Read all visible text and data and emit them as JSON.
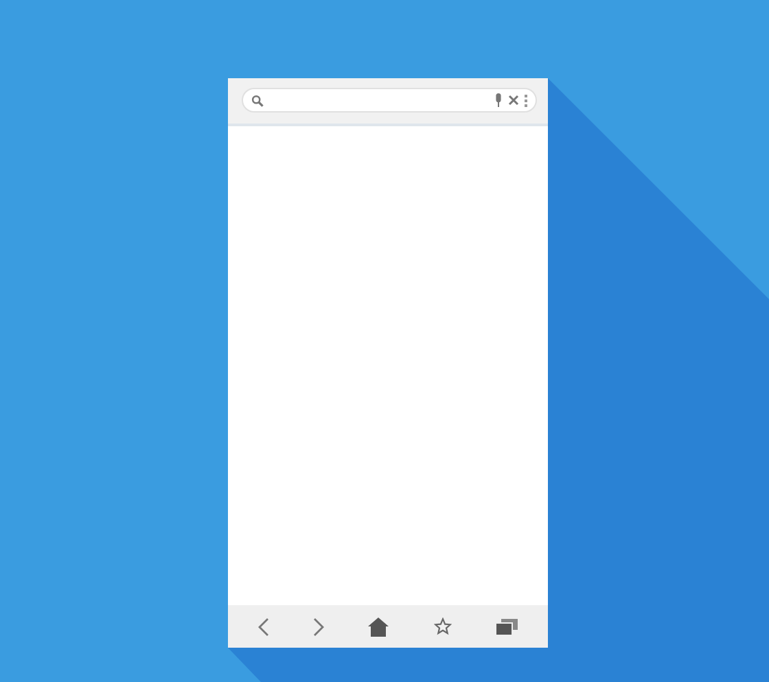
{
  "search_bar": {
    "actions": [
      {
        "kind": "mic"
      },
      {
        "kind": "clear"
      },
      {
        "kind": "menu"
      }
    ]
  },
  "toolbar": [
    {
      "kind": "back"
    },
    {
      "kind": "forward"
    },
    {
      "kind": "home"
    },
    {
      "kind": "bookmark"
    },
    {
      "kind": "tabs"
    }
  ]
}
